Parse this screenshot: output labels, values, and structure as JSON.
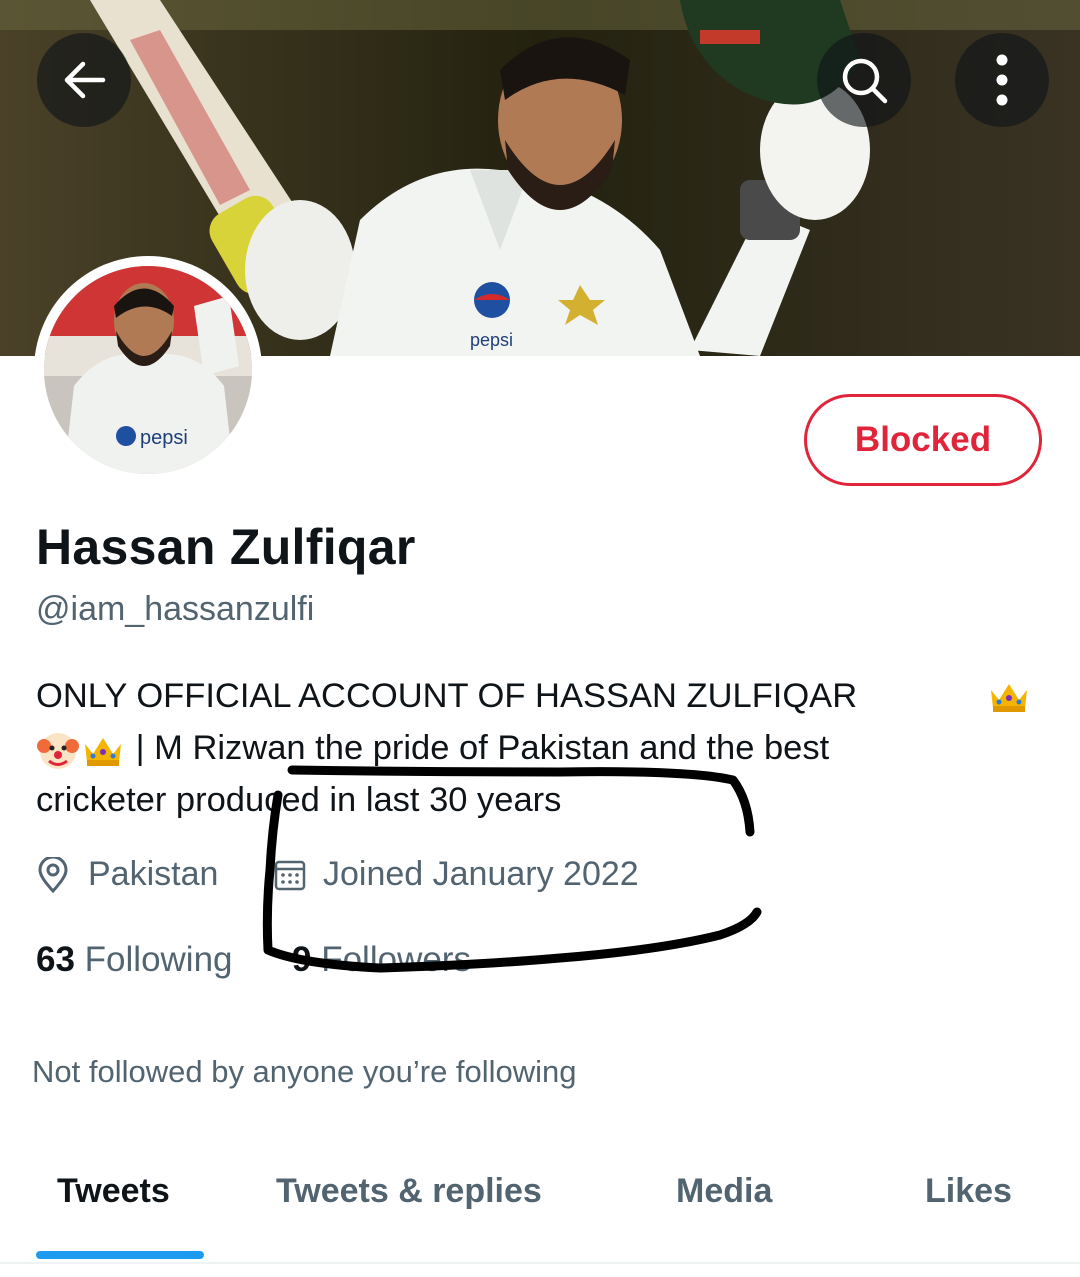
{
  "profile": {
    "display_name": "Hassan Zulfiqar",
    "handle": "@iam_hassanzulfi",
    "bio_line1": "ONLY OFFICIAL ACCOUNT OF HASSAN ZULFIQAR",
    "bio_line2": "| M Rizwan the pride of Pakistan and the best",
    "bio_line3": "cricketer produced in last 30 years",
    "location": "Pakistan",
    "joined": "Joined January 2022",
    "following_count": "63",
    "following_label": "Following",
    "followers_count": "9",
    "followers_label": "Followers",
    "not_followed_text": "Not followed by anyone you’re following",
    "banner_logo_text": "pepsi"
  },
  "actions": {
    "blocked_label": "Blocked"
  },
  "tabs": [
    {
      "label": "Tweets",
      "active": true
    },
    {
      "label": "Tweets & replies",
      "active": false
    },
    {
      "label": "Media",
      "active": false
    },
    {
      "label": "Likes",
      "active": false
    }
  ],
  "icons": {
    "back": "arrow-left-icon",
    "search": "search-icon",
    "more": "more-vertical-icon",
    "location": "location-pin-icon",
    "calendar": "calendar-icon",
    "crown": "crown-emoji",
    "clown": "clown-emoji"
  },
  "colors": {
    "blocked": "#e0243a",
    "accent": "#1d9bf0",
    "secondary_text": "#536471",
    "primary_text": "#0f1419"
  }
}
